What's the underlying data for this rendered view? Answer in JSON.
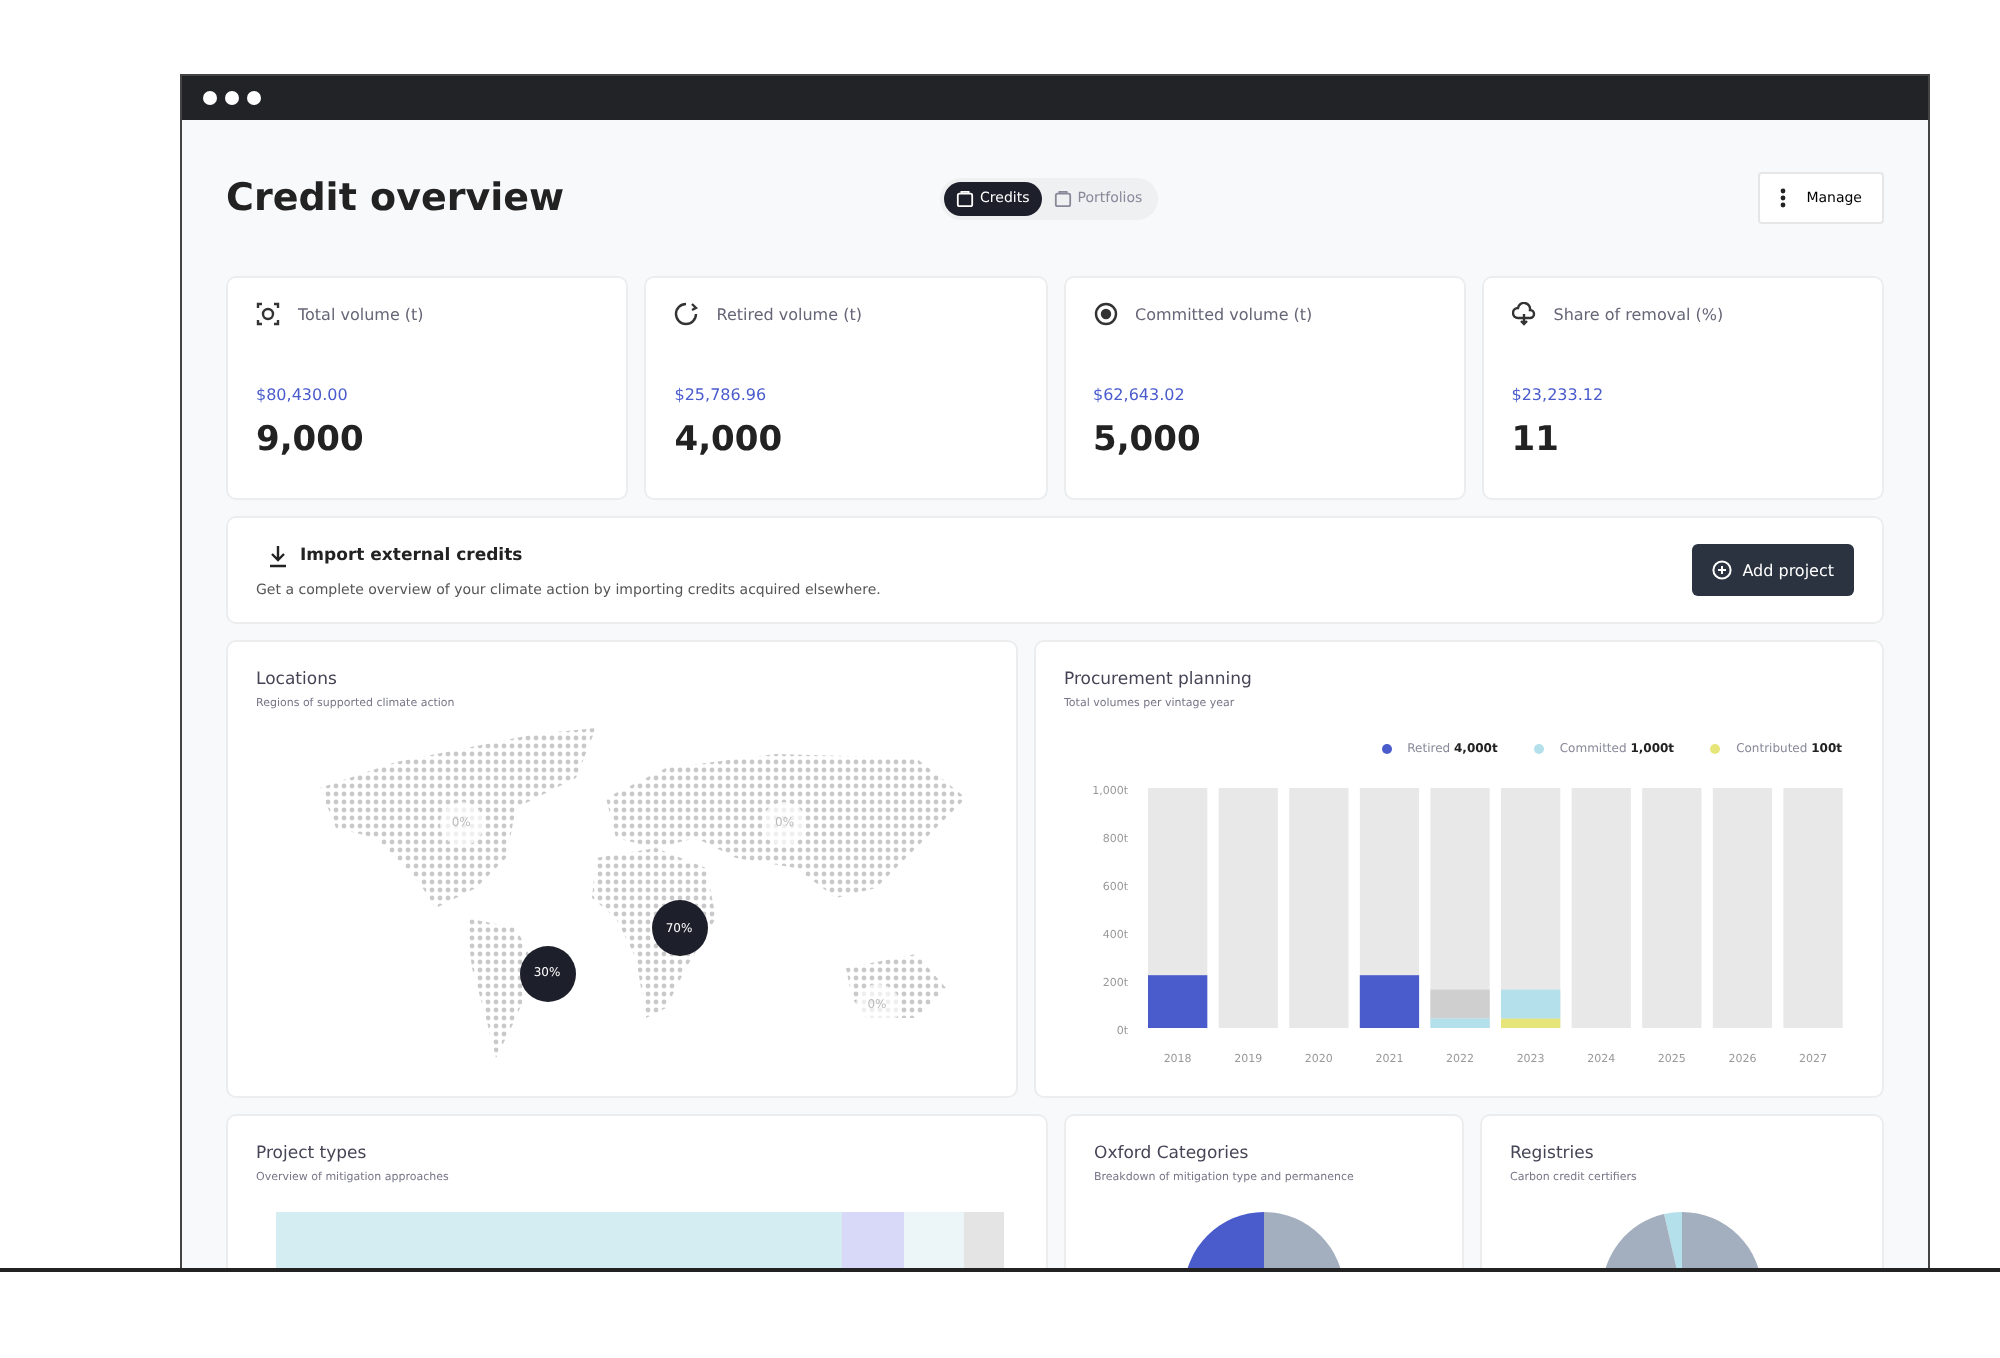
{
  "page": {
    "title": "Credit overview"
  },
  "tabs": [
    {
      "label": "Credits",
      "selected": true
    },
    {
      "label": "Portfolios",
      "selected": false
    }
  ],
  "manage_button": {
    "label": "Manage"
  },
  "stats": [
    {
      "kind": "total",
      "label": "Total volume (t)",
      "amount": "$80,430.00",
      "value": "9,000"
    },
    {
      "kind": "retired",
      "label": "Retired volume (t)",
      "amount": "$25,786.96",
      "value": "4,000"
    },
    {
      "kind": "committed",
      "label": "Committed volume (t)",
      "amount": "$62,643.02",
      "value": "5,000"
    },
    {
      "kind": "removal",
      "label": "Share of removal (%)",
      "amount": "$23,233.12",
      "value": "11"
    }
  ],
  "import": {
    "title": "Import external credits",
    "description": "Get a complete overview of your climate action by importing credits acquired elsewhere.",
    "button": "Add project"
  },
  "locations": {
    "title": "Locations",
    "subtitle": "Regions of supported climate action",
    "markers": [
      {
        "label": "0%",
        "highlighted": false
      },
      {
        "label": "0%",
        "highlighted": false
      },
      {
        "label": "70%",
        "highlighted": true
      },
      {
        "label": "30%",
        "highlighted": true
      },
      {
        "label": "0%",
        "highlighted": false
      }
    ]
  },
  "procurement": {
    "title": "Procurement planning",
    "subtitle": "Total volumes per vintage year",
    "chart_data": {
      "type": "bar",
      "stacked": true,
      "categories": [
        "2018",
        "2019",
        "2020",
        "2021",
        "2022",
        "2023",
        "2024",
        "2025",
        "2026",
        "2027"
      ],
      "ylim": [
        0,
        1000
      ],
      "yticks": [
        {
          "value": 0,
          "label": "0t"
        },
        {
          "value": 200,
          "label": "200t"
        },
        {
          "value": 400,
          "label": "400t"
        },
        {
          "value": 600,
          "label": "600t"
        },
        {
          "value": 800,
          "label": "800t"
        },
        {
          "value": 1000,
          "label": "1,000t"
        }
      ],
      "series": [
        {
          "name": "Retired",
          "color": "#4a5bcc",
          "values": [
            220,
            0,
            0,
            220,
            0,
            0,
            0,
            0,
            0,
            0
          ]
        },
        {
          "name": "Committed",
          "color": "#b3e0ea",
          "values": [
            0,
            0,
            0,
            0,
            40,
            120,
            0,
            0,
            0,
            0
          ]
        },
        {
          "name": "Contributed",
          "color": "#e6e57a",
          "values": [
            0,
            0,
            0,
            0,
            0,
            40,
            0,
            0,
            0,
            0
          ]
        }
      ]
    },
    "legend_totals": [
      "4,000t",
      "1,000t",
      "100t"
    ]
  },
  "bottom_cards": [
    {
      "kind": "bar",
      "title": "Project types",
      "subtitle": "Overview of mitigation approaches"
    },
    {
      "kind": "pie",
      "title": "Oxford Categories",
      "subtitle": "Breakdown of mitigation type and permanence"
    },
    {
      "kind": "pie2",
      "title": "Registries",
      "subtitle": "Carbon credit certifiers"
    }
  ]
}
